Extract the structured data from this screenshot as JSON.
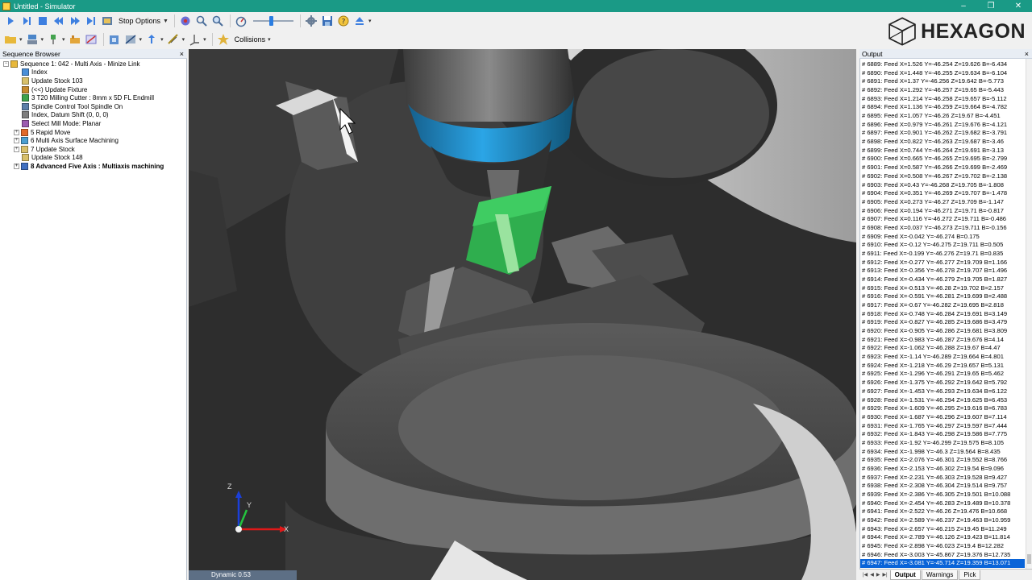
{
  "window": {
    "title": "Untitled - Simulator",
    "controls": [
      "–",
      "❐",
      "✕"
    ]
  },
  "toolbar": {
    "stop_options_label": "Stop Options",
    "collisions_label": "Collisions"
  },
  "brand": {
    "logo_text": "HEXAGON"
  },
  "sequence_browser": {
    "title": "Sequence Browser",
    "items": [
      {
        "label": "Sequence 1: 042 - Multi Axis - Minize Link",
        "indent": 0,
        "expander": "−",
        "icon": "sequence-icon"
      },
      {
        "label": "Index",
        "indent": 1,
        "icon": "index-icon"
      },
      {
        "label": "Update Stock 103",
        "indent": 1,
        "icon": "stock-icon"
      },
      {
        "label": "(<<) Update Fixture",
        "indent": 1,
        "icon": "fixture-icon"
      },
      {
        "label": "3 T20 Milling Cutter : 8mm x 5D FL Endmill",
        "indent": 1,
        "icon": "tool-icon"
      },
      {
        "label": "Spindle Control Tool Spindle On",
        "indent": 1,
        "icon": "spindle-icon"
      },
      {
        "label": "Index, Datum Shift (0, 0, 0)",
        "indent": 1,
        "icon": "datum-icon"
      },
      {
        "label": "Select Mill Mode: Planar",
        "indent": 1,
        "icon": "mode-icon"
      },
      {
        "label": "5 Rapid Move",
        "indent": 1,
        "expander": "+",
        "icon": "rapid-icon"
      },
      {
        "label": "6 Multi Axis Surface Machining",
        "indent": 1,
        "expander": "+",
        "icon": "surface-icon"
      },
      {
        "label": "7 Update Stock",
        "indent": 1,
        "expander": "+",
        "icon": "stock-icon"
      },
      {
        "label": "Update Stock 148",
        "indent": 1,
        "icon": "stock-icon"
      },
      {
        "label": "8 Advanced Five Axis : Multiaxis machining",
        "indent": 1,
        "expander": "+",
        "icon": "fiveaxis-icon",
        "bold": true
      }
    ]
  },
  "viewport": {
    "status_text": "Dynamic 0.53",
    "axis_labels": {
      "x": "X",
      "y": "Y",
      "z": "Z"
    }
  },
  "output": {
    "title": "Output",
    "lines": [
      "# 6889: Feed X=1.526 Y=-46.254 Z=19.626 B=-6.434",
      "# 6890: Feed X=1.448 Y=-46.255 Z=19.634 B=-6.104",
      "# 6891: Feed X=1.37 Y=-46.256 Z=19.642 B=-5.773",
      "# 6892: Feed X=1.292 Y=-46.257 Z=19.65 B=-5.443",
      "# 6893: Feed X=1.214 Y=-46.258 Z=19.657 B=-5.112",
      "# 6894: Feed X=1.136 Y=-46.259 Z=19.664 B=-4.782",
      "# 6895: Feed X=1.057 Y=-46.26 Z=19.67 B=-4.451",
      "# 6896: Feed X=0.979 Y=-46.261 Z=19.676 B=-4.121",
      "# 6897: Feed X=0.901 Y=-46.262 Z=19.682 B=-3.791",
      "# 6898: Feed X=0.822 Y=-46.263 Z=19.687 B=-3.46",
      "# 6899: Feed X=0.744 Y=-46.264 Z=19.691 B=-3.13",
      "# 6900: Feed X=0.665 Y=-46.265 Z=19.695 B=-2.799",
      "# 6901: Feed X=0.587 Y=-46.266 Z=19.699 B=-2.469",
      "# 6902: Feed X=0.508 Y=-46.267 Z=19.702 B=-2.138",
      "# 6903: Feed X=0.43 Y=-46.268 Z=19.705 B=-1.808",
      "# 6904: Feed X=0.351 Y=-46.269 Z=19.707 B=-1.478",
      "# 6905: Feed X=0.273 Y=-46.27 Z=19.709 B=-1.147",
      "# 6906: Feed X=0.194 Y=-46.271 Z=19.71 B=-0.817",
      "# 6907: Feed X=0.116 Y=-46.272 Z=19.711 B=-0.486",
      "# 6908: Feed X=0.037 Y=-46.273 Z=19.711 B=-0.156",
      "# 6909: Feed X=-0.042 Y=-46.274 B=0.175",
      "# 6910: Feed X=-0.12 Y=-46.275 Z=19.711 B=0.505",
      "# 6911: Feed X=-0.199 Y=-46.276 Z=19.71 B=0.835",
      "# 6912: Feed X=-0.277 Y=-46.277 Z=19.709 B=1.166",
      "# 6913: Feed X=-0.356 Y=-46.278 Z=19.707 B=1.496",
      "# 6914: Feed X=-0.434 Y=-46.279 Z=19.705 B=1.827",
      "# 6915: Feed X=-0.513 Y=-46.28 Z=19.702 B=2.157",
      "# 6916: Feed X=-0.591 Y=-46.281 Z=19.699 B=2.488",
      "# 6917: Feed X=-0.67 Y=-46.282 Z=19.695 B=2.818",
      "# 6918: Feed X=-0.748 Y=-46.284 Z=19.691 B=3.149",
      "# 6919: Feed X=-0.827 Y=-46.285 Z=19.686 B=3.479",
      "# 6920: Feed X=-0.905 Y=-46.286 Z=19.681 B=3.809",
      "# 6921: Feed X=-0.983 Y=-46.287 Z=19.676 B=4.14",
      "# 6922: Feed X=-1.062 Y=-46.288 Z=19.67 B=4.47",
      "# 6923: Feed X=-1.14 Y=-46.289 Z=19.664 B=4.801",
      "# 6924: Feed X=-1.218 Y=-46.29 Z=19.657 B=5.131",
      "# 6925: Feed X=-1.296 Y=-46.291 Z=19.65 B=5.462",
      "# 6926: Feed X=-1.375 Y=-46.292 Z=19.642 B=5.792",
      "# 6927: Feed X=-1.453 Y=-46.293 Z=19.634 B=6.122",
      "# 6928: Feed X=-1.531 Y=-46.294 Z=19.625 B=6.453",
      "# 6929: Feed X=-1.609 Y=-46.295 Z=19.616 B=6.783",
      "# 6930: Feed X=-1.687 Y=-46.296 Z=19.607 B=7.114",
      "# 6931: Feed X=-1.765 Y=-46.297 Z=19.597 B=7.444",
      "# 6932: Feed X=-1.843 Y=-46.298 Z=19.586 B=7.775",
      "# 6933: Feed X=-1.92 Y=-46.299 Z=19.575 B=8.105",
      "# 6934: Feed X=-1.998 Y=-46.3 Z=19.564 B=8.435",
      "# 6935: Feed X=-2.076 Y=-46.301 Z=19.552 B=8.766",
      "# 6936: Feed X=-2.153 Y=-46.302 Z=19.54 B=9.096",
      "# 6937: Feed X=-2.231 Y=-46.303 Z=19.528 B=9.427",
      "# 6938: Feed X=-2.308 Y=-46.304 Z=19.514 B=9.757",
      "# 6939: Feed X=-2.386 Y=-46.305 Z=19.501 B=10.088",
      "# 6940: Feed X=-2.454 Y=-46.283 Z=19.489 B=10.378",
      "# 6941: Feed X=-2.522 Y=-46.26 Z=19.476 B=10.668",
      "# 6942: Feed X=-2.589 Y=-46.237 Z=19.463 B=10.959",
      "# 6943: Feed X=-2.657 Y=-46.215 Z=19.45 B=11.249",
      "# 6944: Feed X=-2.789 Y=-46.126 Z=19.423 B=11.814",
      "# 6945: Feed X=-2.898 Y=-46.023 Z=19.4 B=12.282",
      "# 6946: Feed X=-3.003 Y=-45.867 Z=19.376 B=12.735",
      "# 6947: Feed X=-3.081 Y=-45.714 Z=19.359 B=13.071"
    ],
    "selected_index": 58,
    "tabs": [
      {
        "label": "Output",
        "active": true
      },
      {
        "label": "Warnings",
        "active": false
      },
      {
        "label": "Pick",
        "active": false
      }
    ]
  },
  "colors": {
    "titlebar": "#1a9a86",
    "selection": "#0a64d8",
    "spindle_band": "#1f8fd0",
    "stock_green": "#2fae4e"
  }
}
